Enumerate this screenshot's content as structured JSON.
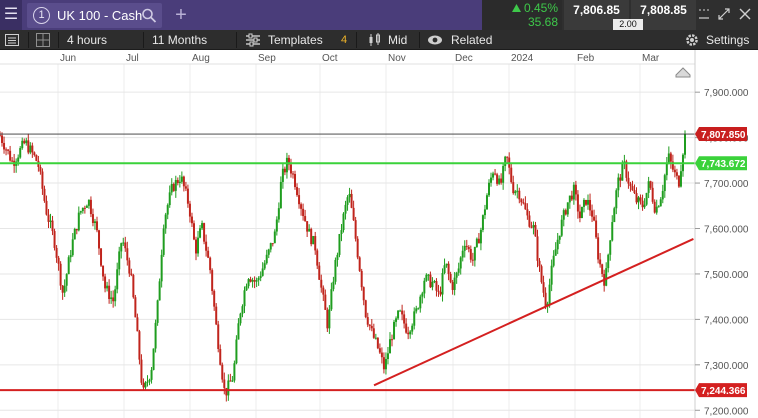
{
  "tab": {
    "number": "1",
    "title": "UK 100 - Cash"
  },
  "quote": {
    "change_pct": "0.45%",
    "change_pts": "35.68",
    "sell": "7,806.85",
    "buy": "7,808.85",
    "spread": "2.00",
    "up_color": "#3ec84a"
  },
  "toolbar": {
    "interval": "4 hours",
    "range": "11 Months",
    "templates": "Templates",
    "templates_count": "4",
    "price_type": "Mid",
    "related": "Related",
    "settings": "Settings"
  },
  "icons": [
    "menu-icon",
    "search-icon",
    "add-tab-icon",
    "up-triangle-icon",
    "minimize-icon",
    "resize-icon",
    "close-icon",
    "list-icon",
    "grid-icon",
    "templates-icon",
    "candles-icon",
    "eye-icon",
    "gear-icon",
    "scroll-up-icon"
  ],
  "chart_data": {
    "type": "line",
    "instrument": "UK 100 - Cash",
    "interval": "4 hours",
    "range": "11 Months",
    "x_tick_labels": [
      "Jun",
      "Jul",
      "Aug",
      "Sep",
      "Oct",
      "Nov",
      "Dec",
      "2024",
      "Feb",
      "Mar"
    ],
    "y_tick_labels": [
      "7,900.000",
      "7,800.000",
      "7,700.000",
      "7,600.000",
      "7,500.000",
      "7,400.000",
      "7,300.000",
      "7,200.000"
    ],
    "ylim": [
      7183,
      7962
    ],
    "xlim": [
      0,
      326
    ],
    "colors": {
      "up": "#1f9d1f",
      "down": "#c0241c",
      "grid": "#e6e6e6"
    },
    "series": [
      {
        "values": [
          [
            0,
            7805
          ],
          [
            6,
            7745
          ],
          [
            12,
            7790
          ],
          [
            18,
            7745
          ],
          [
            22,
            7640
          ],
          [
            26,
            7570
          ],
          [
            30,
            7455
          ],
          [
            34,
            7560
          ],
          [
            38,
            7635
          ],
          [
            42,
            7665
          ],
          [
            46,
            7595
          ],
          [
            50,
            7470
          ],
          [
            54,
            7440
          ],
          [
            58,
            7580
          ],
          [
            62,
            7505
          ],
          [
            65,
            7380
          ],
          [
            68,
            7235
          ],
          [
            72,
            7290
          ],
          [
            75,
            7430
          ],
          [
            78,
            7620
          ],
          [
            82,
            7690
          ],
          [
            86,
            7715
          ],
          [
            90,
            7650
          ],
          [
            93,
            7550
          ],
          [
            96,
            7605
          ],
          [
            100,
            7510
          ],
          [
            103,
            7380
          ],
          [
            107,
            7235
          ],
          [
            111,
            7275
          ],
          [
            114,
            7410
          ],
          [
            118,
            7500
          ],
          [
            122,
            7480
          ],
          [
            127,
            7535
          ],
          [
            131,
            7590
          ],
          [
            134,
            7710
          ],
          [
            137,
            7750
          ],
          [
            140,
            7710
          ],
          [
            143,
            7655
          ],
          [
            147,
            7590
          ],
          [
            150,
            7560
          ],
          [
            153,
            7465
          ],
          [
            156,
            7385
          ],
          [
            159,
            7505
          ],
          [
            163,
            7615
          ],
          [
            166,
            7680
          ],
          [
            168,
            7620
          ],
          [
            171,
            7520
          ],
          [
            174,
            7415
          ],
          [
            177,
            7370
          ],
          [
            180,
            7335
          ],
          [
            183,
            7290
          ],
          [
            186,
            7360
          ],
          [
            190,
            7415
          ],
          [
            194,
            7375
          ],
          [
            198,
            7415
          ],
          [
            202,
            7490
          ],
          [
            206,
            7480
          ],
          [
            209,
            7450
          ],
          [
            212,
            7525
          ],
          [
            215,
            7470
          ],
          [
            218,
            7505
          ],
          [
            221,
            7575
          ],
          [
            225,
            7530
          ],
          [
            229,
            7600
          ],
          [
            232,
            7680
          ],
          [
            235,
            7735
          ],
          [
            238,
            7690
          ],
          [
            241,
            7760
          ],
          [
            244,
            7690
          ],
          [
            247,
            7680
          ],
          [
            251,
            7625
          ],
          [
            254,
            7600
          ],
          [
            257,
            7500
          ],
          [
            260,
            7430
          ],
          [
            263,
            7520
          ],
          [
            266,
            7590
          ],
          [
            270,
            7655
          ],
          [
            273,
            7685
          ],
          [
            276,
            7625
          ],
          [
            279,
            7665
          ],
          [
            282,
            7630
          ],
          [
            285,
            7530
          ],
          [
            288,
            7480
          ],
          [
            291,
            7610
          ],
          [
            294,
            7700
          ],
          [
            297,
            7740
          ],
          [
            300,
            7690
          ],
          [
            303,
            7660
          ],
          [
            306,
            7650
          ],
          [
            309,
            7700
          ],
          [
            312,
            7640
          ],
          [
            315,
            7680
          ],
          [
            318,
            7760
          ],
          [
            321,
            7720
          ],
          [
            323,
            7700
          ],
          [
            326,
            7807.85
          ]
        ]
      }
    ],
    "annotations": {
      "current_price": {
        "label": "7,807.850",
        "value": 7807.85,
        "color": "#c81e1e"
      },
      "resistance": {
        "label": "7,743.672",
        "value": 7743.672,
        "color": "#3ad23a"
      },
      "support": {
        "label": "7,244.366",
        "value": 7244.366,
        "color": "#d42020"
      },
      "trendline": {
        "from": [
          178,
          7255
        ],
        "to": [
          330,
          7577
        ],
        "color": "#d42020"
      }
    }
  }
}
